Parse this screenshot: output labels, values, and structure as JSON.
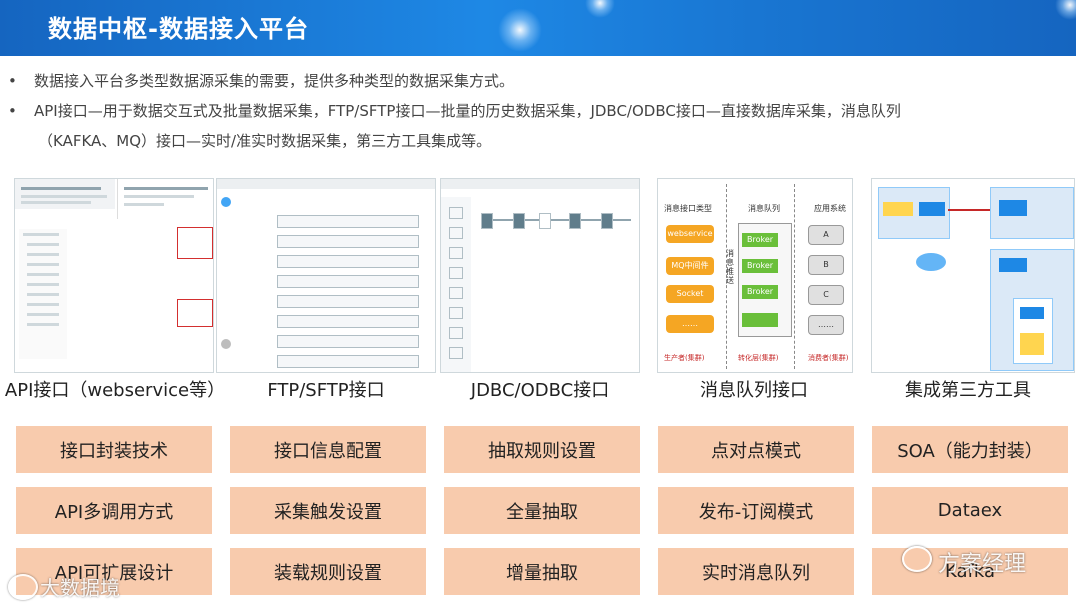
{
  "header": {
    "title": "数据中枢-数据接入平台"
  },
  "bullets": [
    "数据接入平台多类型数据源采集的需要，提供多种类型的数据采集方式。",
    "API接口—用于数据交互式及批量数据采集，FTP/SFTP接口—批量的历史数据采集，JDBC/ODBC接口—直接数据库采集，消息队列",
    "（KAFKA、MQ）接口—实时/准实时数据采集，第三方工具集成等。"
  ],
  "bullet_mark": "•",
  "columns": [
    {
      "title": "API接口（webservice等）",
      "features": [
        "接口封装技术",
        "API多调用方式",
        "API可扩展设计"
      ]
    },
    {
      "title": "FTP/SFTP接口",
      "features": [
        "接口信息配置",
        "采集触发设置",
        "装载规则设置"
      ]
    },
    {
      "title": "JDBC/ODBC接口",
      "features": [
        "抽取规则设置",
        "全量抽取",
        "增量抽取"
      ]
    },
    {
      "title": "消息队列接口",
      "features": [
        "点对点模式",
        "发布-订阅模式",
        "实时消息队列"
      ]
    },
    {
      "title": "集成第三方工具",
      "features": [
        "SOA（能力封装）",
        "Dataex",
        "Kafka"
      ]
    }
  ],
  "mq_diagram": {
    "col_headers": [
      "消息接口类型",
      "消息队列",
      "应用系统"
    ],
    "producers": [
      "webservice",
      "MQ中间件",
      "Socket",
      "……"
    ],
    "brokers": [
      "Broker",
      "Broker",
      "Broker",
      ""
    ],
    "consumers": [
      "A",
      "B",
      "C",
      "……"
    ],
    "footer": [
      "生产者(集群)",
      "转化层(集群)",
      "消费者(集群)"
    ],
    "side_label": "消息推送"
  },
  "watermarks": {
    "left": "大数据境",
    "right": "方案经理"
  },
  "colors": {
    "header_blue": "#1976d2",
    "feature_fill": "#f8cbad",
    "mq_orange": "#f5a623",
    "mq_green": "#6abf3a"
  },
  "icons": [
    "wechat-icon",
    "logo-icon"
  ]
}
